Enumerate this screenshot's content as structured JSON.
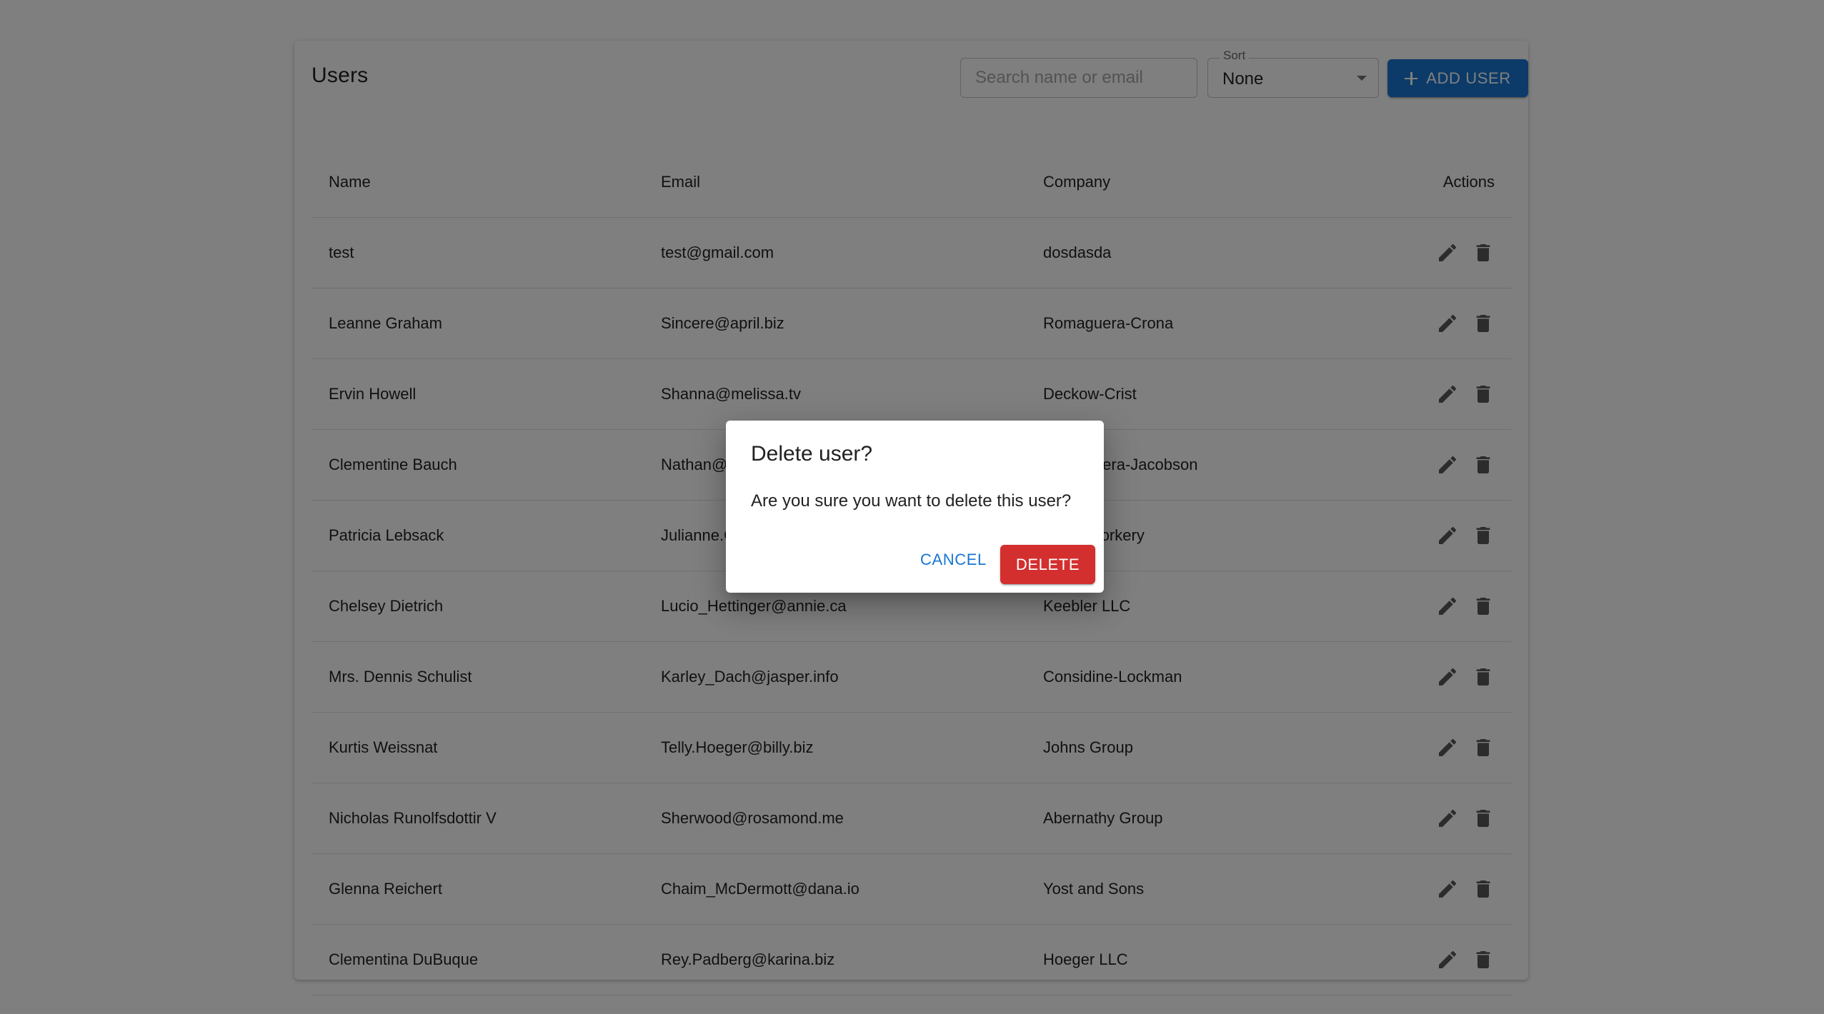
{
  "header": {
    "title": "Users",
    "search_placeholder": "Search name or email",
    "search_value": "",
    "sort_label": "Sort",
    "sort_value": "None",
    "add_button_label": "ADD USER"
  },
  "table": {
    "columns": [
      "Name",
      "Email",
      "Company",
      "Actions"
    ],
    "rows": [
      {
        "name": "test",
        "email": "test@gmail.com",
        "company": "dosdasda"
      },
      {
        "name": "Leanne Graham",
        "email": "Sincere@april.biz",
        "company": "Romaguera-Crona"
      },
      {
        "name": "Ervin Howell",
        "email": "Shanna@melissa.tv",
        "company": "Deckow-Crist"
      },
      {
        "name": "Clementine Bauch",
        "email": "Nathan@yesenia.net",
        "company": "Romaguera-Jacobson"
      },
      {
        "name": "Patricia Lebsack",
        "email": "Julianne.OConner@kory.org",
        "company": "Robel-Corkery"
      },
      {
        "name": "Chelsey Dietrich",
        "email": "Lucio_Hettinger@annie.ca",
        "company": "Keebler LLC"
      },
      {
        "name": "Mrs. Dennis Schulist",
        "email": "Karley_Dach@jasper.info",
        "company": "Considine-Lockman"
      },
      {
        "name": "Kurtis Weissnat",
        "email": "Telly.Hoeger@billy.biz",
        "company": "Johns Group"
      },
      {
        "name": "Nicholas Runolfsdottir V",
        "email": "Sherwood@rosamond.me",
        "company": "Abernathy Group"
      },
      {
        "name": "Glenna Reichert",
        "email": "Chaim_McDermott@dana.io",
        "company": "Yost and Sons"
      },
      {
        "name": "Clementina DuBuque",
        "email": "Rey.Padberg@karina.biz",
        "company": "Hoeger LLC"
      }
    ],
    "row_action_icons": [
      "edit-icon",
      "delete-icon"
    ]
  },
  "dialog": {
    "title": "Delete user?",
    "message": "Are you sure you want to delete this user?",
    "cancel_label": "CANCEL",
    "delete_label": "DELETE"
  },
  "colors": {
    "primary": "#1976d2",
    "danger": "#d32f2f",
    "overlay": "rgba(0,0,0,0.5)"
  }
}
